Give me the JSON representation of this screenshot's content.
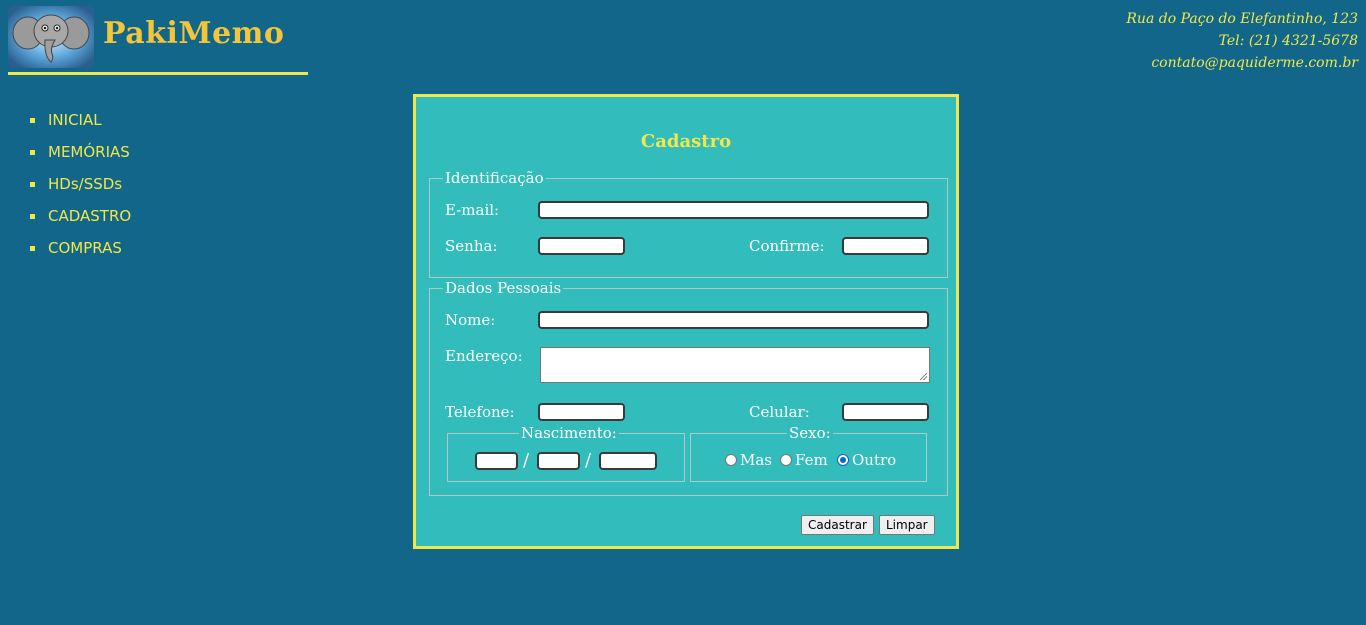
{
  "header": {
    "brand": "PakiMemo",
    "logo_icon": "elephant-icon",
    "contact": {
      "address": "Rua do Paço do Elefantinho, 123",
      "phone": "Tel: (21) 4321-5678",
      "email": "contato@paquiderme.com.br"
    }
  },
  "nav": {
    "items": [
      {
        "label": "INICIAL"
      },
      {
        "label": "MEMÓRIAS"
      },
      {
        "label": "HDs/SSDs"
      },
      {
        "label": "CADASTRO"
      },
      {
        "label": "COMPRAS"
      }
    ]
  },
  "form": {
    "title": "Cadastro",
    "identificacao": {
      "legend": "Identificação",
      "email_label": "E-mail:",
      "email_value": "",
      "senha_label": "Senha:",
      "senha_value": "",
      "confirme_label": "Confirme:",
      "confirme_value": ""
    },
    "dados_pessoais": {
      "legend": "Dados Pessoais",
      "nome_label": "Nome:",
      "nome_value": "",
      "endereco_label": "Endereço:",
      "endereco_value": "",
      "telefone_label": "Telefone:",
      "telefone_value": "",
      "celular_label": "Celular:",
      "celular_value": "",
      "nascimento": {
        "legend": "Nascimento:",
        "separator": "/",
        "day": "",
        "month": "",
        "year": ""
      },
      "sexo": {
        "legend": "Sexo:",
        "options": [
          {
            "label": "Mas",
            "checked": false
          },
          {
            "label": "Fem",
            "checked": false
          },
          {
            "label": "Outro",
            "checked": true
          }
        ]
      }
    },
    "buttons": {
      "submit": "Cadastrar",
      "reset": "Limpar"
    }
  },
  "colors": {
    "background": "#12668a",
    "accent": "#f0e84a",
    "brand": "#f2c53a",
    "panel": "#33bcbc"
  }
}
